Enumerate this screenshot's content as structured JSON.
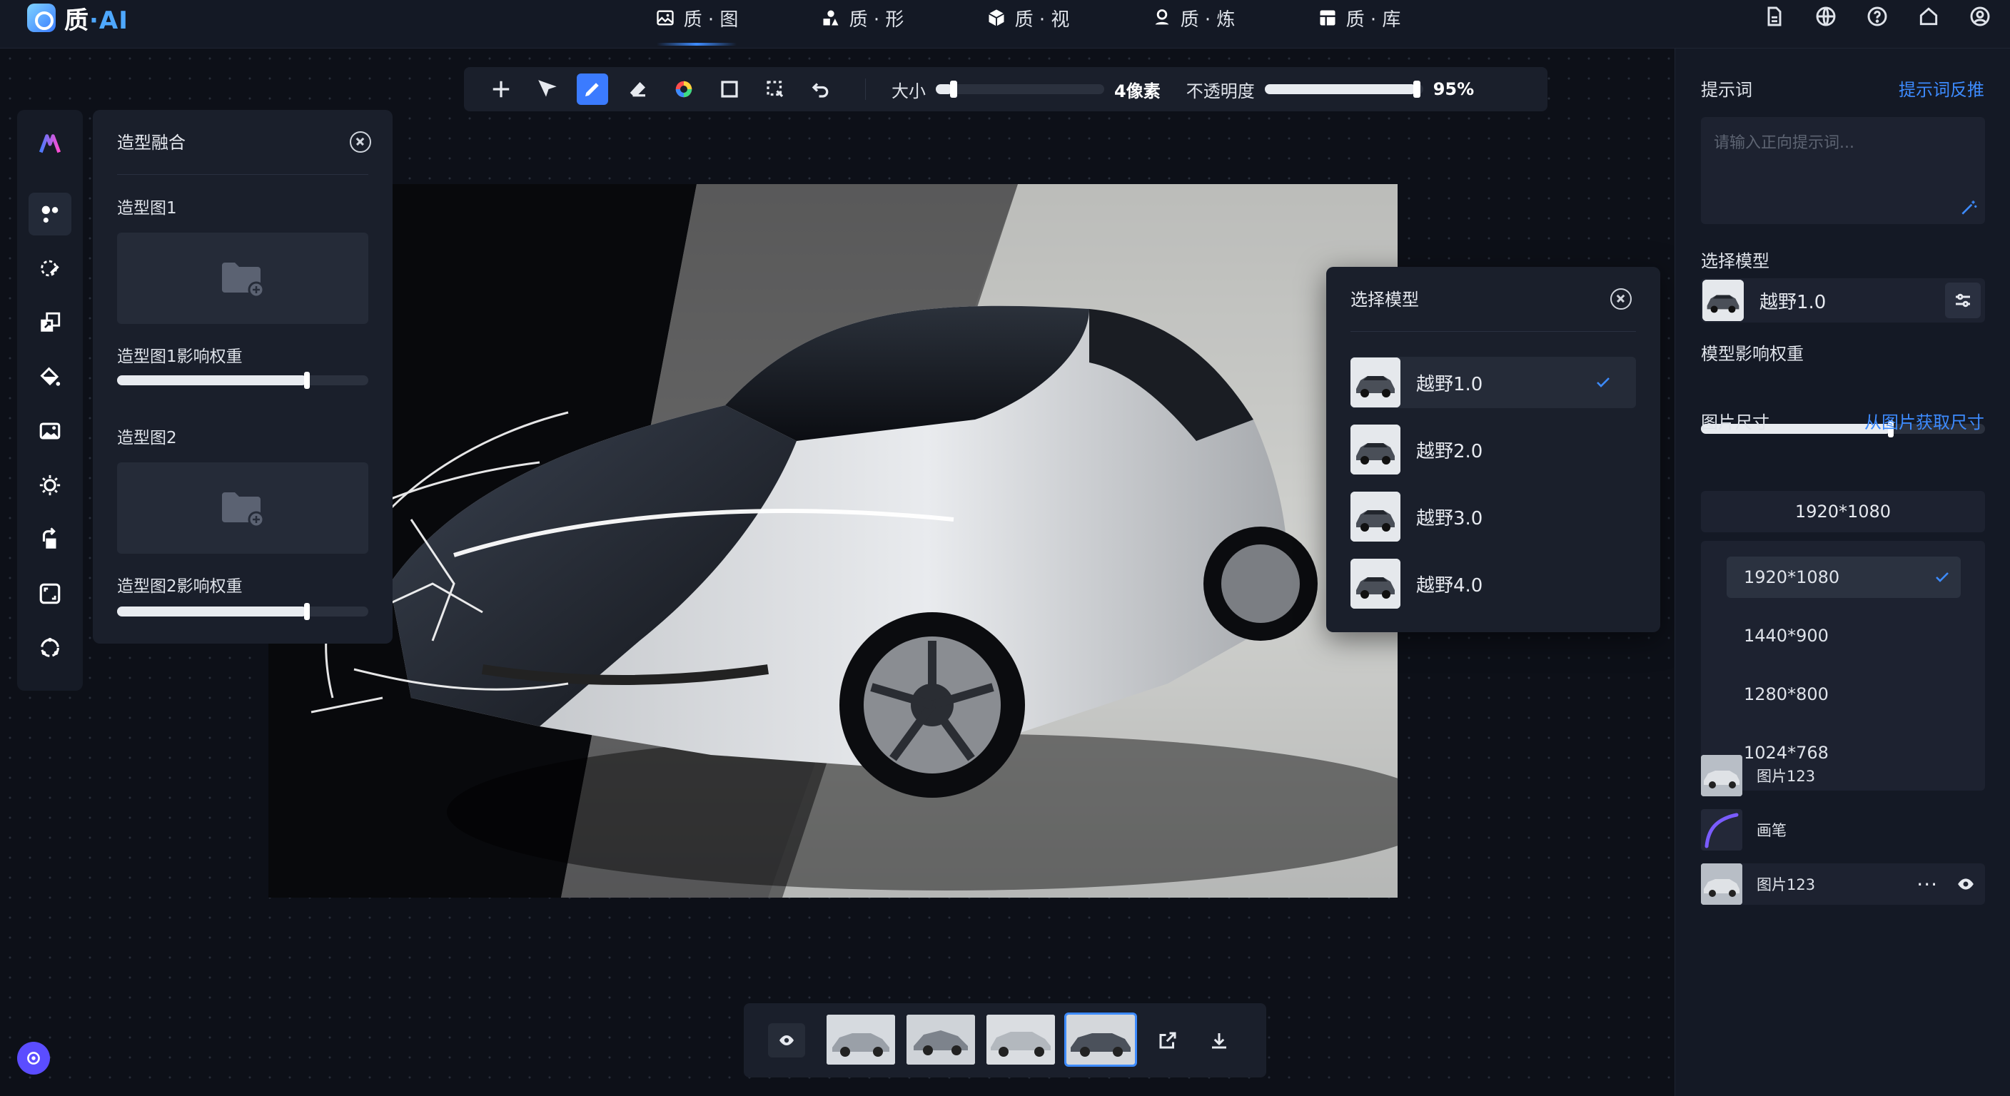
{
  "app": {
    "brand_main": "质",
    "brand_dot": "·",
    "brand_ai": "AI"
  },
  "nav": {
    "tabs": [
      {
        "label": "质 · 图"
      },
      {
        "label": "质 · 形"
      },
      {
        "label": "质 · 视"
      },
      {
        "label": "质 · 炼"
      },
      {
        "label": "质 · 库"
      }
    ],
    "active_index": 0
  },
  "toolbar": {
    "size_label": "大小",
    "size_value": "4像素",
    "opacity_label": "不透明度",
    "opacity_value": "95%",
    "opacity_fraction": 0.95
  },
  "left_panel": {
    "title": "造型融合",
    "image1_label": "造型图1",
    "image1_weight_label": "造型图1影响权重",
    "image2_label": "造型图2",
    "image2_weight_label": "造型图2影响权重"
  },
  "model_popup": {
    "title": "选择模型",
    "items": [
      {
        "label": "越野1.0",
        "selected": true
      },
      {
        "label": "越野2.0"
      },
      {
        "label": "越野3.0"
      },
      {
        "label": "越野4.0"
      }
    ]
  },
  "right_panel": {
    "prompt_label": "提示词",
    "prompt_feedback_link": "提示词反推",
    "prompt_placeholder": "请输入正向提示词...",
    "model_label": "选择模型",
    "model_value": "越野1.0",
    "weight_label": "模型影响权重",
    "size_label": "图片尺寸",
    "size_link": "从图片获取尺寸",
    "size_value": "1920*1080",
    "size_options": [
      "1920*1080",
      "1440*900",
      "1280*800",
      "1024*768"
    ],
    "layers": [
      {
        "name": "图片123"
      },
      {
        "name": "画笔"
      },
      {
        "name": "图片123",
        "more": "···"
      }
    ]
  },
  "colors": {
    "accent": "#3d8bff",
    "bg": "#0d1018",
    "panel": "#1a1f2b"
  }
}
